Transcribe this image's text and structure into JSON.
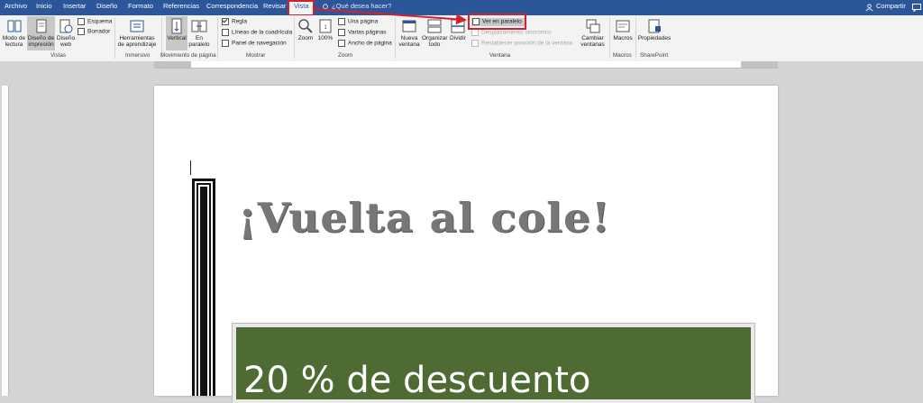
{
  "tabs": [
    "Archivo",
    "Inicio",
    "Insertar",
    "Diseño",
    "Formato",
    "Referencias",
    "Correspondencia",
    "Revisar",
    "Vista"
  ],
  "active_tab": "Vista",
  "tell_me": "¿Qué desea hacer?",
  "share_label": "Compartir",
  "ribbon": {
    "vistas": {
      "mode_reading": "Modo de lectura",
      "print_layout": "Diseño de impresión",
      "web_layout": "Diseño web",
      "outline": "Esquema",
      "draft": "Borrador",
      "group": "Vistas"
    },
    "inmersivo": {
      "learning_tools": "Herramientas de aprendizaje",
      "group": "Inmersivo"
    },
    "movimiento": {
      "vertical": "Vertical",
      "side_to_side": "En paralelo",
      "group": "Movimiento de página"
    },
    "mostrar": {
      "ruler": "Regla",
      "gridlines": "Líneas de la cuadrícula",
      "nav_pane": "Panel de navegación",
      "group": "Mostrar"
    },
    "zoom": {
      "zoom": "Zoom",
      "hundred": "100%",
      "one_page": "Una página",
      "multiple_pages": "Varias páginas",
      "page_width": "Ancho de página",
      "group": "Zoom"
    },
    "ventana": {
      "new_window": "Nueva ventana",
      "arrange_all": "Organizar todo",
      "split": "Dividir",
      "side_by_side": "Ver en paralelo",
      "sync_scroll": "Desplazamiento sincrónico",
      "reset_position": "Restablecer posición de la ventana",
      "switch_windows": "Cambiar ventanas",
      "group": "Ventana"
    },
    "macros": {
      "macros": "Macros",
      "group": "Macros"
    },
    "sharepoint": {
      "properties": "Propiedades",
      "group": "SharePoint"
    }
  },
  "ruler_state": {
    "regla": true,
    "lineas": false,
    "panel": false
  },
  "document": {
    "heading": "¡Vuelta al cole!",
    "banner_text": "20 % de descuento"
  },
  "colors": {
    "accent": "#2b579a",
    "highlight": "#d1222b",
    "banner": "#4e6b33"
  }
}
